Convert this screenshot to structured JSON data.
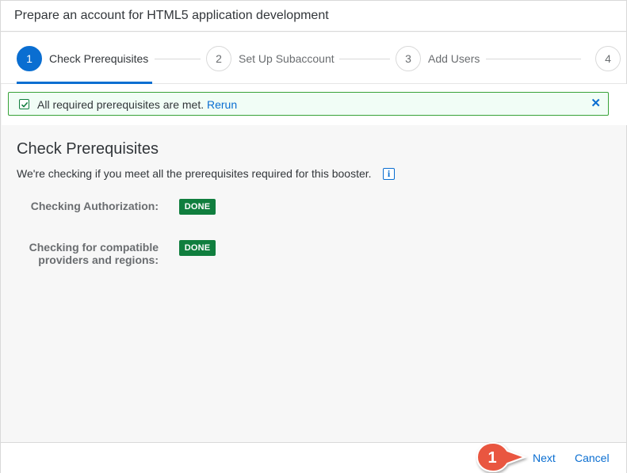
{
  "dialog": {
    "title": "Prepare an account for HTML5 application development"
  },
  "wizard": {
    "steps": [
      {
        "number": "1",
        "label": "Check Prerequisites"
      },
      {
        "number": "2",
        "label": "Set Up Subaccount"
      },
      {
        "number": "3",
        "label": "Add Users"
      },
      {
        "number": "4",
        "label": ""
      }
    ],
    "active_step": 1
  },
  "banner": {
    "message": "All required prerequisites are met.",
    "link": "Rerun",
    "close": "✕"
  },
  "content": {
    "title": "Check Prerequisites",
    "description": "We're checking if you meet all the prerequisites required for this booster.",
    "info_icon": "i",
    "checks": [
      {
        "label_line1": "Checking Authorization:",
        "label_line2": "",
        "status": "DONE"
      },
      {
        "label_line1": "Checking for compatible",
        "label_line2": "providers and regions:",
        "status": "DONE"
      }
    ]
  },
  "footer": {
    "next_label": "Next",
    "cancel_label": "Cancel"
  },
  "annotation": {
    "number": "1"
  },
  "colors": {
    "accent": "#0a6ed1",
    "success": "#107e3e",
    "callout": "#e9573f"
  }
}
